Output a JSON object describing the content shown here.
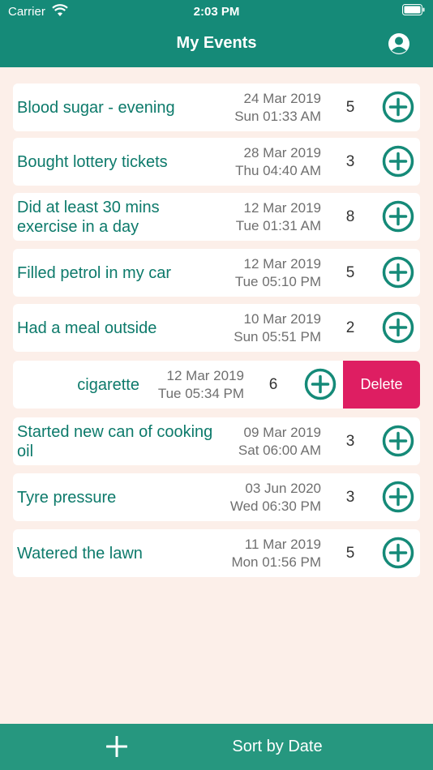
{
  "status_bar": {
    "carrier": "Carrier",
    "time": "2:03 PM"
  },
  "nav": {
    "title": "My Events",
    "profile_icon": "person-circle-icon"
  },
  "events": [
    {
      "name": "Blood sugar - evening",
      "date": "24 Mar 2019",
      "time": "Sun 01:33 AM",
      "count": "5"
    },
    {
      "name": "Bought lottery tickets",
      "date": "28 Mar 2019",
      "time": "Thu 04:40 AM",
      "count": "3"
    },
    {
      "name": "Did at least 30 mins exercise in a day",
      "date": "12 Mar 2019",
      "time": "Tue 01:31 AM",
      "count": "8"
    },
    {
      "name": "Filled petrol in my car",
      "date": "12 Mar 2019",
      "time": "Tue 05:10 PM",
      "count": "5"
    },
    {
      "name": "Had a meal outside",
      "date": "10 Mar 2019",
      "time": "Sun 05:51 PM",
      "count": "2"
    },
    {
      "name": "cigarette",
      "date": "12 Mar 2019",
      "time": "Tue 05:34 PM",
      "count": "6",
      "delete_label": "Delete"
    },
    {
      "name": "Started new can of cooking oil",
      "date": "09 Mar 2019",
      "time": "Sat 06:00 AM",
      "count": "3"
    },
    {
      "name": "Tyre pressure",
      "date": "03 Jun 2020",
      "time": "Wed 06:30 PM",
      "count": "3"
    },
    {
      "name": "Watered the lawn",
      "date": "11 Mar 2019",
      "time": "Mon 01:56 PM",
      "count": "5"
    }
  ],
  "bottom_bar": {
    "add_icon": "plus-icon",
    "sort_label": "Sort by Date"
  },
  "colors": {
    "primary": "#158a78",
    "bottom_bar": "#26977f",
    "text": "#0d7a6b",
    "background": "#fcefe9",
    "delete": "#de1e62"
  }
}
